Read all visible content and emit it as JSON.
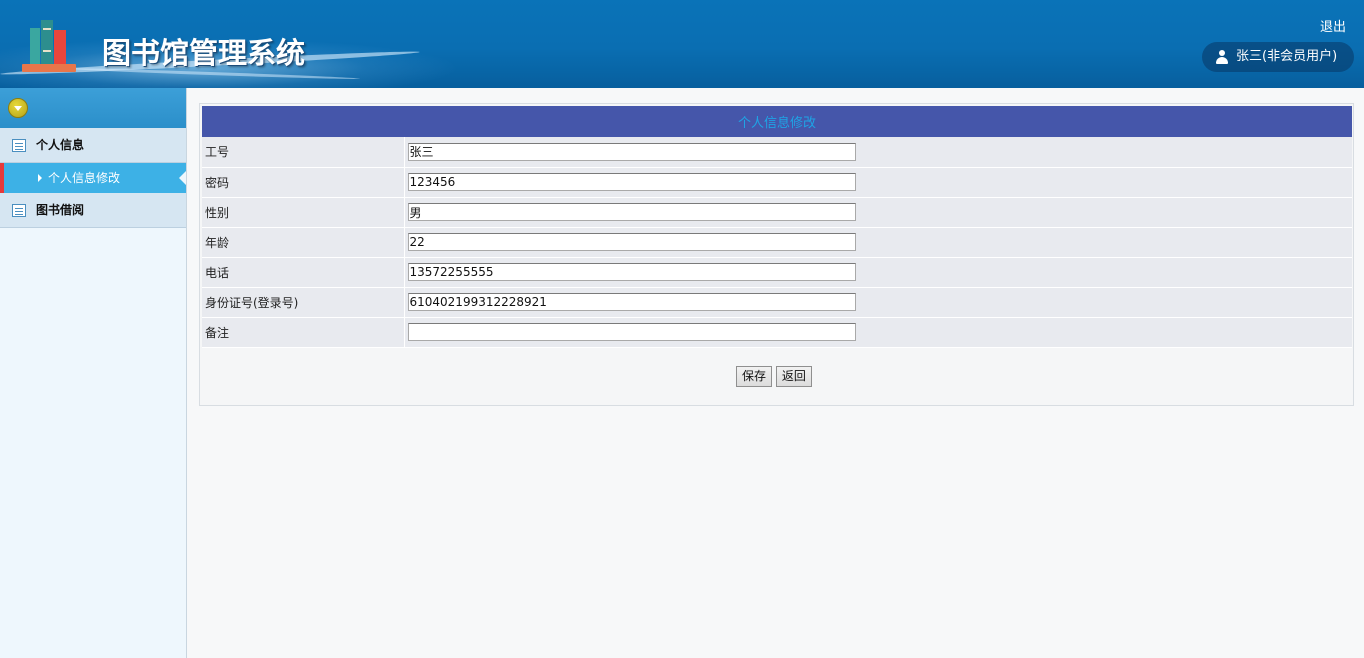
{
  "header": {
    "app_title": "图书馆管理系统",
    "logout_label": "退出",
    "user_label": "张三(非会员用户)",
    "colors": {
      "header_bg": "#0a6eb2",
      "title_text": "#ffffff"
    }
  },
  "sidebar": {
    "groups": [
      {
        "label": "个人信息",
        "icon": "list-icon",
        "items": [
          {
            "label": "个人信息修改",
            "active": true
          }
        ]
      },
      {
        "label": "图书借阅",
        "icon": "list-icon",
        "items": []
      }
    ],
    "colors": {
      "active_bg": "#3db1e6",
      "active_marker": "#e6393a"
    }
  },
  "form": {
    "title": "个人信息修改",
    "fields": [
      {
        "label": "工号",
        "value": "张三"
      },
      {
        "label": "密码",
        "value": "123456"
      },
      {
        "label": "性别",
        "value": "男"
      },
      {
        "label": "年龄",
        "value": "22"
      },
      {
        "label": "电话",
        "value": "13572255555"
      },
      {
        "label": "身份证号(登录号)",
        "value": "610402199312228921"
      },
      {
        "label": "备注",
        "value": ""
      }
    ],
    "save_label": "保存",
    "back_label": "返回",
    "colors": {
      "title_bar_bg": "#4556aa",
      "title_text": "#1ea4e6"
    }
  }
}
